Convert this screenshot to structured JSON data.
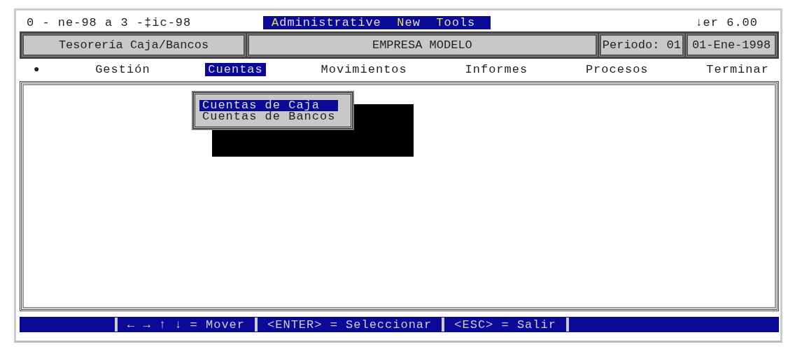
{
  "header": {
    "date_range": "0 - ne-98 a 3 -‡ic-98",
    "title_words": [
      "Administrative",
      "New",
      "Tools"
    ],
    "version": "↓er 6.00"
  },
  "info_bar": {
    "module": "Tesorería Caja/Bancos",
    "company": "EMPRESA MODELO",
    "period": "Periodo: 01",
    "date": "01-Ene-1998"
  },
  "menu": {
    "icon_char": "●",
    "items": [
      {
        "label": "Gestión",
        "selected": false
      },
      {
        "label": "Cuentas",
        "selected": true
      },
      {
        "label": "Movimientos",
        "selected": false
      },
      {
        "label": "Informes",
        "selected": false
      },
      {
        "label": "Procesos",
        "selected": false
      },
      {
        "label": "Terminar",
        "selected": false
      }
    ]
  },
  "dropdown": {
    "items": [
      {
        "label": "Cuentas de Caja",
        "selected": true
      },
      {
        "label": "Cuentas de Bancos",
        "selected": false
      }
    ]
  },
  "status_bar": [
    "← → ↑ ↓ = Mover",
    "<ENTER> = Seleccionar",
    "<ESC> = Salir"
  ]
}
